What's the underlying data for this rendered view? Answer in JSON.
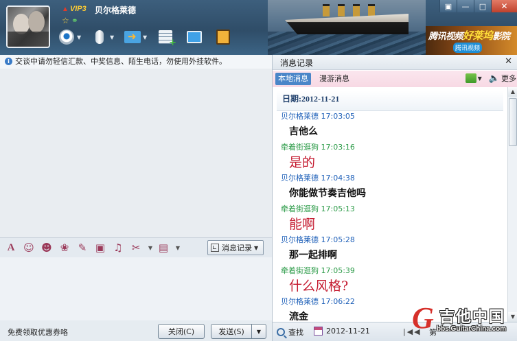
{
  "header": {
    "vip_label": "VIP3",
    "contact_name": "贝尔格莱德",
    "ad": {
      "line1": "腾讯视频",
      "highlight": "好莱坞",
      "line1_end": "影院",
      "line2": "腾讯视频"
    }
  },
  "notice": "交谈中请勿轻信汇款、中奖信息、陌生电话，勿使用外挂软件。",
  "input_toolbar": {
    "icons": [
      "font-icon",
      "emoji-icon",
      "magic-face-icon",
      "theme-icon",
      "edit-icon",
      "image-icon",
      "music-icon",
      "scissors-icon",
      "shortcut-icon"
    ],
    "message_record_label": "消息记录"
  },
  "bottom": {
    "coupon_link": "免费领取优惠券咯",
    "close_label": "关闭(C)",
    "send_label": "发送(S)"
  },
  "history_panel": {
    "title": "消息记录",
    "tabs": [
      "本地消息",
      "漫游消息"
    ],
    "more_label": "更多",
    "date_header": "日期:2012-11-21",
    "messages": [
      {
        "sender": "贝尔格莱德",
        "time": "17:03:05",
        "text": "吉他么",
        "side": "peer"
      },
      {
        "sender": "牵着街逛狗",
        "time": "17:03:16",
        "text": "是的",
        "side": "me"
      },
      {
        "sender": "贝尔格莱德",
        "time": "17:04:38",
        "text": "你能做节奏吉他吗",
        "side": "peer"
      },
      {
        "sender": "牵着街逛狗",
        "time": "17:05:13",
        "text": "能啊",
        "side": "me"
      },
      {
        "sender": "贝尔格莱德",
        "time": "17:05:28",
        "text": "那一起排啊",
        "side": "peer"
      },
      {
        "sender": "牵着街逛狗",
        "time": "17:05:39",
        "text": "什么风格?",
        "side": "me"
      },
      {
        "sender": "贝尔格莱德",
        "time": "17:06:22",
        "text": "流金",
        "side": "peer"
      }
    ],
    "footer": {
      "find_label": "查找",
      "date_value": "2012-11-21",
      "page_label": "第"
    }
  },
  "watermark": {
    "logo_letter": "G",
    "site_name": "吉他中国",
    "site_url": "bbs.GuitarChina.com"
  },
  "colors": {
    "peer_name": "#1d5fb8",
    "my_name": "#2c9b48",
    "my_text": "#c4192e",
    "active_tab": "#4a86c8"
  }
}
